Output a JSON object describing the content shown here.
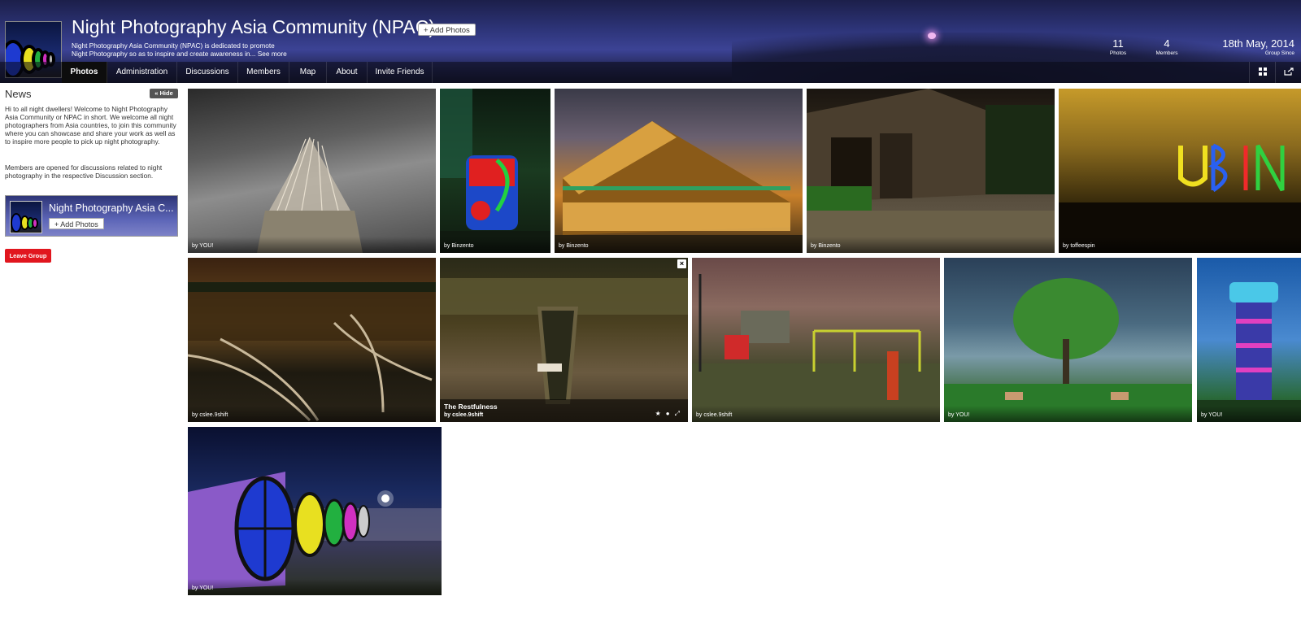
{
  "header": {
    "title": "Night Photography Asia Community (NPAC)",
    "add_photos_label": "+ Add Photos",
    "description": "Night Photography Asia Community (NPAC) is dedicated to promote Night Photography so as to inspire and create awareness in...",
    "see_more": "See more",
    "stats": [
      {
        "num": "11",
        "label": "Photos"
      },
      {
        "num": "4",
        "label": "Members"
      },
      {
        "num": "18th May, 2014",
        "label": "Group Since"
      }
    ]
  },
  "nav": {
    "tabs": [
      "Photos",
      "Administration",
      "Discussions",
      "Members",
      "Map",
      "About",
      "Invite Friends"
    ],
    "active": "Photos",
    "icons": [
      "grid-view-icon",
      "share-icon"
    ]
  },
  "sidebar": {
    "news_title": "News",
    "hide_label": "« Hide",
    "paragraph1": "Hi to all night dwellers! Welcome to Night Photography Asia Community or NPAC in short. We welcome all night photographers from Asia countries, to join this community where you can showcase and share your work as well as to inspire more people to pick up night photography.",
    "paragraph2": "Members are opened for discussions related to night photography in the respective Discussion section.",
    "card_title": "Night Photography Asia C...",
    "card_add_label": "+ Add Photos",
    "leave_label": "Leave Group"
  },
  "photos": [
    {
      "by": "by YOU!"
    },
    {
      "by": "by Binzento"
    },
    {
      "by": "by Binzento"
    },
    {
      "by": "by Binzento"
    },
    {
      "by": "by toffeespin"
    },
    {
      "by": "by cslee.9shift"
    },
    {
      "title": "The Restfulness",
      "by": "by cslee.9shift"
    },
    {
      "by": "by cslee.9shift"
    },
    {
      "by": "by YOU!"
    },
    {
      "by": "by YOU!"
    },
    {
      "by": "by YOU!"
    }
  ],
  "colors": {
    "leave": "#e1161e",
    "nav_active": "#0d0d0d"
  }
}
